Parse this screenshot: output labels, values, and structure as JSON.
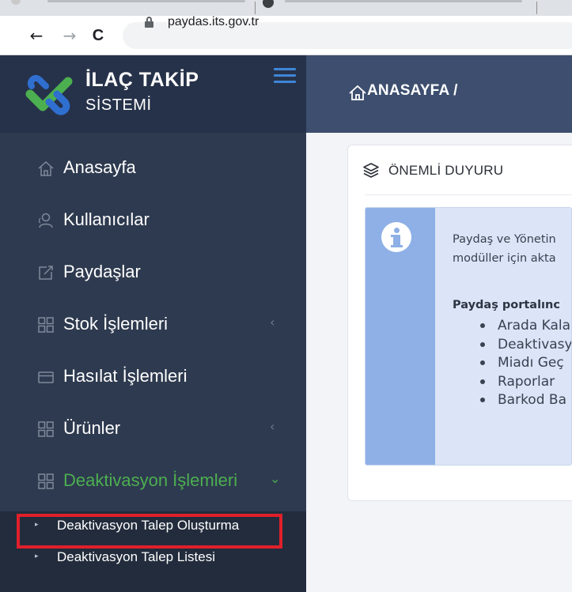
{
  "browser": {
    "url": "paydas.its.gov.tr",
    "back_glyph": "←",
    "forward_glyph": "→",
    "reload_glyph": "C"
  },
  "brand": {
    "title": "İLAÇ TAKİP",
    "subtitle": "SİSTEMİ",
    "logo_colors": {
      "green": "#4caf50",
      "blue": "#2f6fd0"
    }
  },
  "sidebar": {
    "items": [
      {
        "label": "Anasayfa",
        "icon": "home-icon",
        "arrow": ""
      },
      {
        "label": "Kullanıcılar",
        "icon": "users-icon",
        "arrow": ""
      },
      {
        "label": "Paydaşlar",
        "icon": "share-icon",
        "arrow": ""
      },
      {
        "label": "Stok İşlemleri",
        "icon": "grid-icon",
        "arrow": "‹"
      },
      {
        "label": "Hasılat İşlemleri",
        "icon": "card-icon",
        "arrow": ""
      },
      {
        "label": "Ürünler",
        "icon": "grid-icon",
        "arrow": "‹"
      },
      {
        "label": "Deaktivasyon İşlemleri",
        "icon": "grid-icon",
        "arrow": "⌄"
      }
    ],
    "sub_items": [
      {
        "label": "Deaktivasyon Talep Oluşturma",
        "bullet": "▸"
      },
      {
        "label": "Deaktivasyon Talep Listesi",
        "bullet": "▸"
      }
    ],
    "active_color": "#4caf50",
    "highlight_color": "#e0202a"
  },
  "header": {
    "breadcrumb": "ANASAYFA /"
  },
  "card": {
    "title": "ÖNEMLİ DUYURU",
    "alert": {
      "line1": "Paydaş ve Yönetin",
      "line2": "modüller için akta",
      "bold": "Paydaş portalınc",
      "bullets": [
        "Arada Kala",
        "Deaktivasy",
        "Miadı Geç",
        "Raporlar",
        "Barkod Ba"
      ]
    }
  }
}
